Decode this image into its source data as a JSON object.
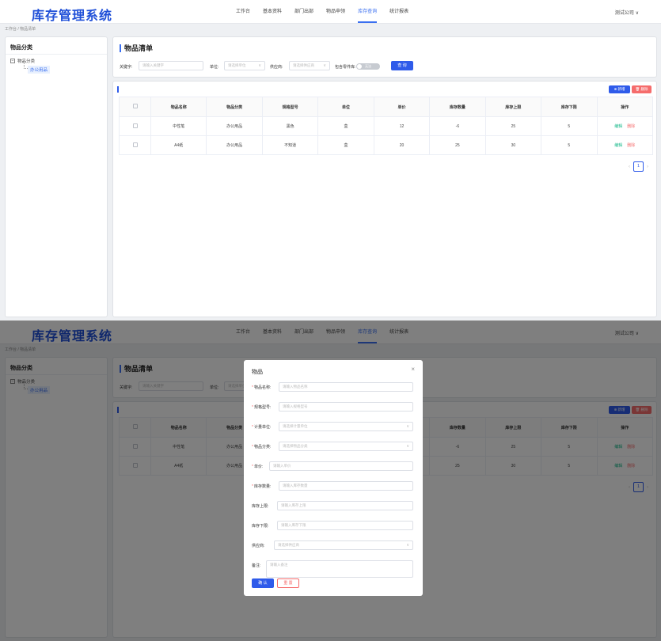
{
  "app": {
    "title": "库存管理系统",
    "company": "测试公司"
  },
  "nav": [
    "工作台",
    "基本资料",
    "部门出部",
    "物品申领",
    "库存查询",
    "统计报表"
  ],
  "nav_active": 4,
  "breadcrumb": "工作台 / 物品清单",
  "sidebar": {
    "title": "物品分类",
    "root": "物品分类",
    "child": "办公用品",
    "toggle": "−"
  },
  "search": {
    "title": "物品清单",
    "keyword_label": "关键字:",
    "keyword_placeholder": "请输入关键字",
    "unit_label": "单位:",
    "unit_placeholder": "请选择单位",
    "supplier_label": "供应商:",
    "supplier_placeholder": "请选择供应商",
    "zero_stock_label": "包含零件库:",
    "switch_text": "无法",
    "query_button": "查 询"
  },
  "toolbar": {
    "add_button": "⊕ 新增",
    "delete_button": "🗑 删除"
  },
  "table": {
    "headers": [
      "物品名称",
      "物品分类",
      "规格型号",
      "单位",
      "单价",
      "库存数量",
      "库存上限",
      "库存下限",
      "操作"
    ],
    "rows": [
      [
        "中性笔",
        "办公用品",
        "黑色",
        "盒",
        "12",
        "-6",
        "25",
        "5"
      ],
      [
        "A4纸",
        "办公用品",
        "不知道",
        "盒",
        "20",
        "25",
        "30",
        "5"
      ]
    ],
    "edit": "编辑",
    "delete": "删除"
  },
  "pager": {
    "current": "1",
    "prev": "‹",
    "next": "›"
  },
  "modal": {
    "title": "物品",
    "close": "×",
    "fields": [
      {
        "label": "物品名称:",
        "placeholder": "请输入物品名称",
        "required": true,
        "select": false
      },
      {
        "label": "规格型号:",
        "placeholder": "请输入规格型号",
        "required": true,
        "select": false
      },
      {
        "label": "计量单位:",
        "placeholder": "请选择计量单位",
        "required": true,
        "select": true
      },
      {
        "label": "物品分类:",
        "placeholder": "请选择物品分类",
        "required": true,
        "select": true
      },
      {
        "label": "单价:",
        "placeholder": "请输入单价",
        "required": true,
        "select": false
      },
      {
        "label": "库存数量:",
        "placeholder": "请输入库存数量",
        "required": true,
        "select": false
      },
      {
        "label": "库存上限:",
        "placeholder": "请输入库存上限",
        "required": false,
        "select": false
      },
      {
        "label": "库存下限:",
        "placeholder": "请输入库存下限",
        "required": false,
        "select": false
      },
      {
        "label": "供应商:",
        "placeholder": "请选择供应商",
        "required": false,
        "select": true
      },
      {
        "label": "备注:",
        "placeholder": "请输入备注",
        "required": false,
        "select": false
      }
    ],
    "confirm": "确 认",
    "reset": "重 置"
  },
  "colors": {
    "accent": "#2f5bea",
    "danger": "#f56c6c",
    "success": "#16b889",
    "brand": "#1f4fd8"
  }
}
